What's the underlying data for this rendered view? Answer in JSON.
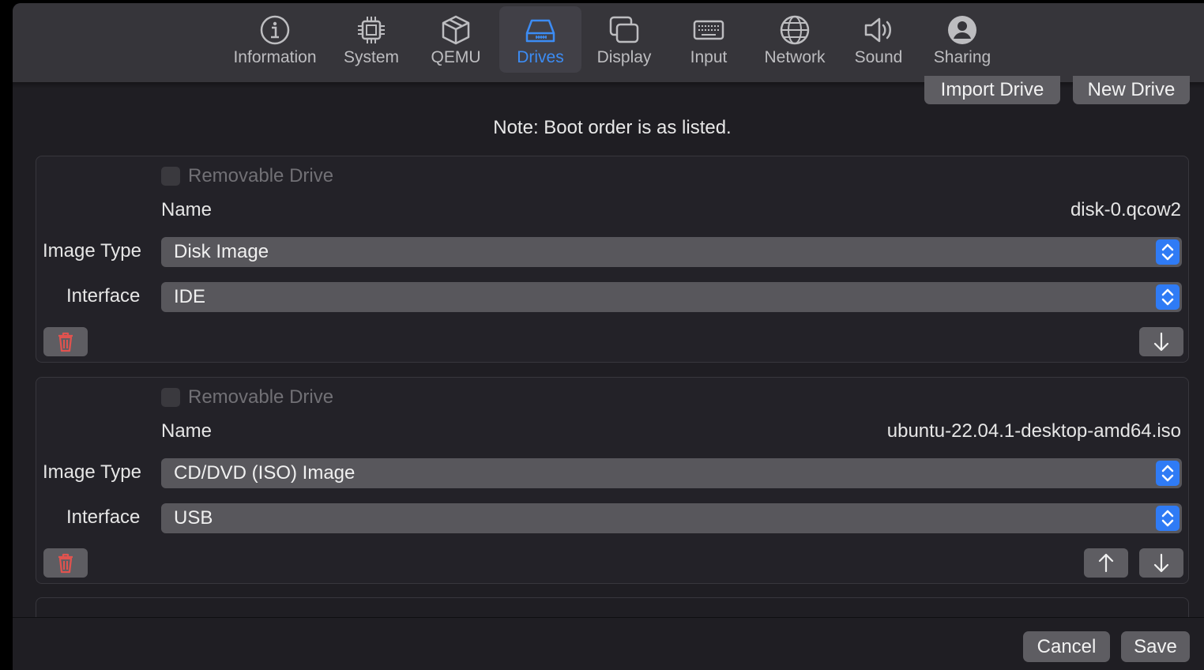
{
  "toolbar": {
    "tabs": [
      {
        "label": "Information",
        "icon": "info-circle-icon"
      },
      {
        "label": "System",
        "icon": "cpu-chip-icon"
      },
      {
        "label": "QEMU",
        "icon": "cube-icon"
      },
      {
        "label": "Drives",
        "icon": "drive-icon",
        "active": true
      },
      {
        "label": "Display",
        "icon": "display-windows-icon"
      },
      {
        "label": "Input",
        "icon": "keyboard-icon"
      },
      {
        "label": "Network",
        "icon": "globe-icon"
      },
      {
        "label": "Sound",
        "icon": "speaker-icon"
      },
      {
        "label": "Sharing",
        "icon": "person-circle-icon"
      }
    ]
  },
  "actions": {
    "import_drive": "Import Drive",
    "new_drive": "New Drive"
  },
  "note": "Note: Boot order is as listed.",
  "drives": [
    {
      "removable_label": "Removable Drive",
      "removable_checked": false,
      "name_label": "Name",
      "name": "disk-0.qcow2",
      "image_type_label": "Image Type",
      "image_type": "Disk Image",
      "interface_label": "Interface",
      "interface": "IDE"
    },
    {
      "removable_label": "Removable Drive",
      "removable_checked": false,
      "name_label": "Name",
      "name": "ubuntu-22.04.1-desktop-amd64.iso",
      "image_type_label": "Image Type",
      "image_type": "CD/DVD (ISO) Image",
      "interface_label": "Interface",
      "interface": "USB"
    }
  ],
  "footer": {
    "cancel": "Cancel",
    "save": "Save"
  },
  "colors": {
    "accent": "#3c8cf4",
    "delete": "#e0534f",
    "toolbar_bg": "#36353a",
    "window_bg": "#1f1e23"
  }
}
